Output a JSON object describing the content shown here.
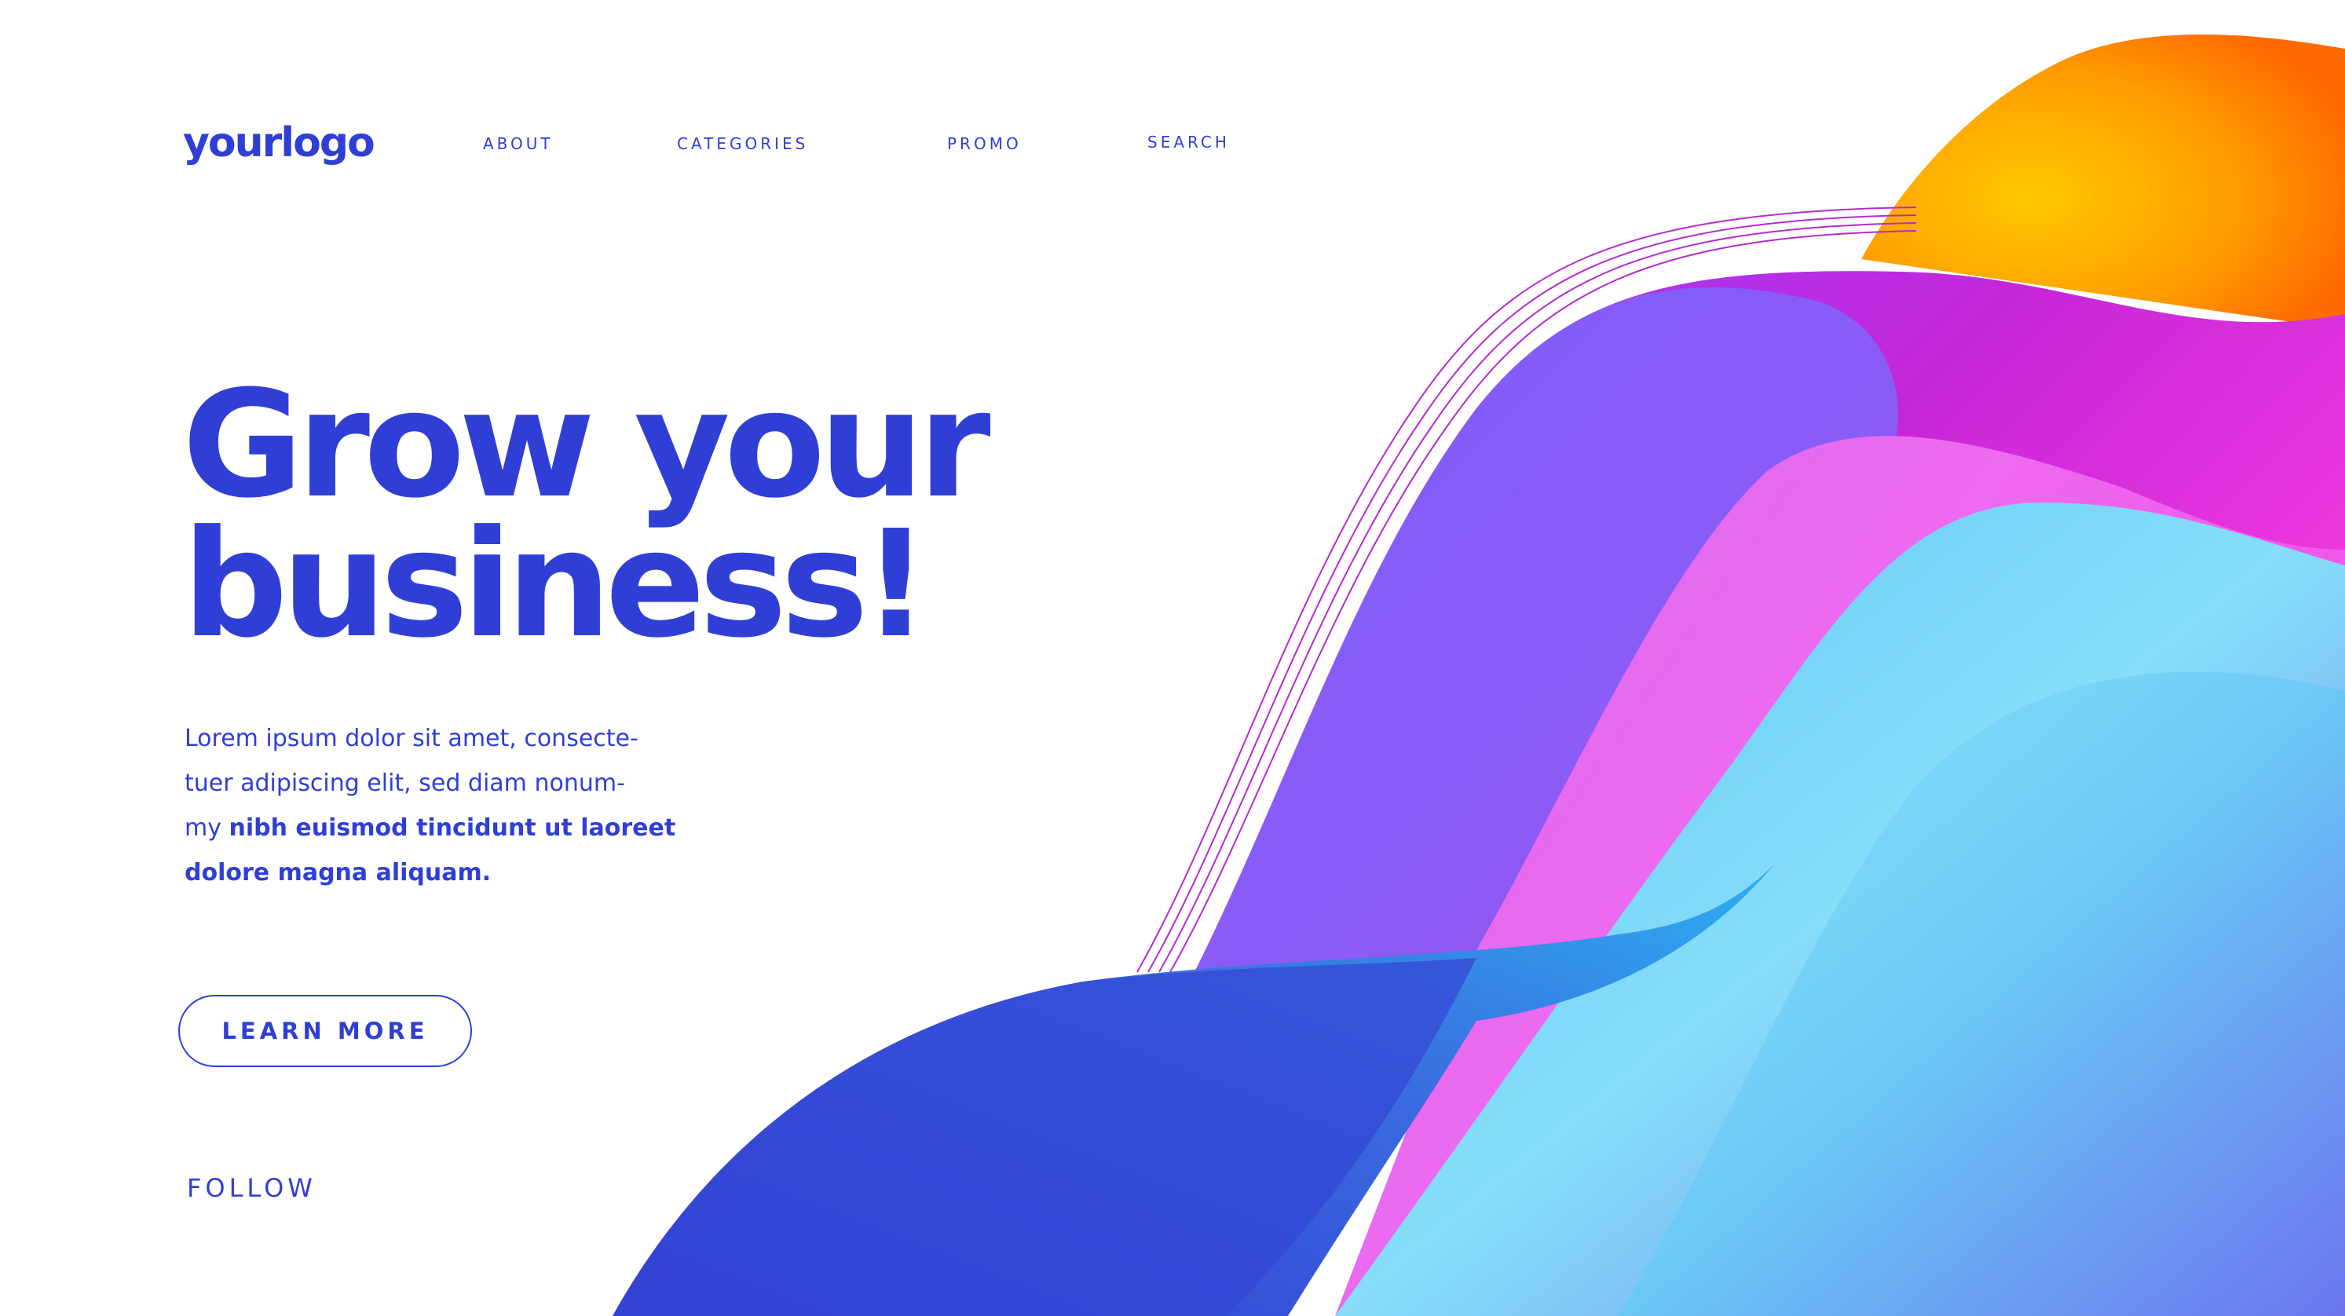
{
  "header": {
    "logo": "yourlogo",
    "nav": {
      "about": "ABOUT",
      "categories": "CATEGORIES",
      "promo": "PROMO",
      "search": "SEARCH"
    }
  },
  "hero": {
    "title_line1": "Grow your",
    "title_line2": "business!",
    "intro_line1": "Lorem ipsum dolor sit amet, consecte-",
    "intro_line2": "tuer adipiscing elit, sed diam nonum-",
    "intro_line3_regular": "my ",
    "intro_line3_bold": "nibh euismod tincidunt ut laoreet",
    "intro_line4_bold": "dolore magna aliquam.",
    "cta_label": "LEARN MORE",
    "follow_label": "FOLLOW"
  },
  "colors": {
    "brand": "#2f3fd6",
    "background": "#ffffff",
    "wave_orange": "#ff9a00",
    "wave_magenta": "#e33fe6",
    "wave_violet": "#7a5cff",
    "wave_cyan": "#5fd0f5",
    "wave_blue": "#3346d4"
  }
}
